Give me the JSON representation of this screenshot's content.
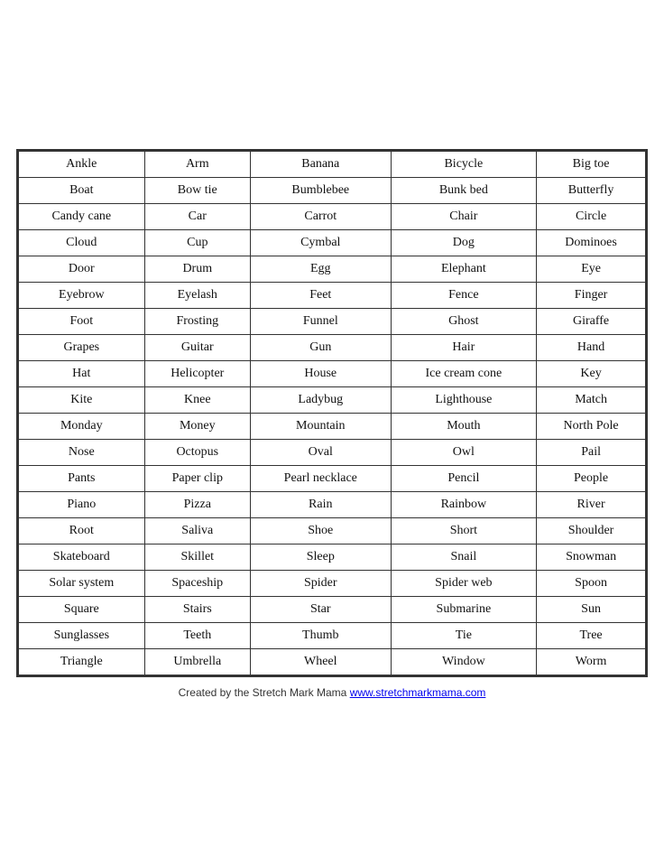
{
  "table": {
    "rows": [
      [
        "Ankle",
        "Arm",
        "Banana",
        "Bicycle",
        "Big toe"
      ],
      [
        "Boat",
        "Bow tie",
        "Bumblebee",
        "Bunk bed",
        "Butterfly"
      ],
      [
        "Candy cane",
        "Car",
        "Carrot",
        "Chair",
        "Circle"
      ],
      [
        "Cloud",
        "Cup",
        "Cymbal",
        "Dog",
        "Dominoes"
      ],
      [
        "Door",
        "Drum",
        "Egg",
        "Elephant",
        "Eye"
      ],
      [
        "Eyebrow",
        "Eyelash",
        "Feet",
        "Fence",
        "Finger"
      ],
      [
        "Foot",
        "Frosting",
        "Funnel",
        "Ghost",
        "Giraffe"
      ],
      [
        "Grapes",
        "Guitar",
        "Gun",
        "Hair",
        "Hand"
      ],
      [
        "Hat",
        "Helicopter",
        "House",
        "Ice cream cone",
        "Key"
      ],
      [
        "Kite",
        "Knee",
        "Ladybug",
        "Lighthouse",
        "Match"
      ],
      [
        "Monday",
        "Money",
        "Mountain",
        "Mouth",
        "North Pole"
      ],
      [
        "Nose",
        "Octopus",
        "Oval",
        "Owl",
        "Pail"
      ],
      [
        "Pants",
        "Paper clip",
        "Pearl necklace",
        "Pencil",
        "People"
      ],
      [
        "Piano",
        "Pizza",
        "Rain",
        "Rainbow",
        "River"
      ],
      [
        "Root",
        "Saliva",
        "Shoe",
        "Short",
        "Shoulder"
      ],
      [
        "Skateboard",
        "Skillet",
        "Sleep",
        "Snail",
        "Snowman"
      ],
      [
        "Solar system",
        "Spaceship",
        "Spider",
        "Spider web",
        "Spoon"
      ],
      [
        "Square",
        "Stairs",
        "Star",
        "Submarine",
        "Sun"
      ],
      [
        "Sunglasses",
        "Teeth",
        "Thumb",
        "Tie",
        "Tree"
      ],
      [
        "Triangle",
        "Umbrella",
        "Wheel",
        "Window",
        "Worm"
      ]
    ]
  },
  "footer": {
    "text": "Created by the Stretch Mark Mama ",
    "link_text": "www.stretchmarkmama.com",
    "link_href": "http://www.stretchmarkmama.com"
  }
}
